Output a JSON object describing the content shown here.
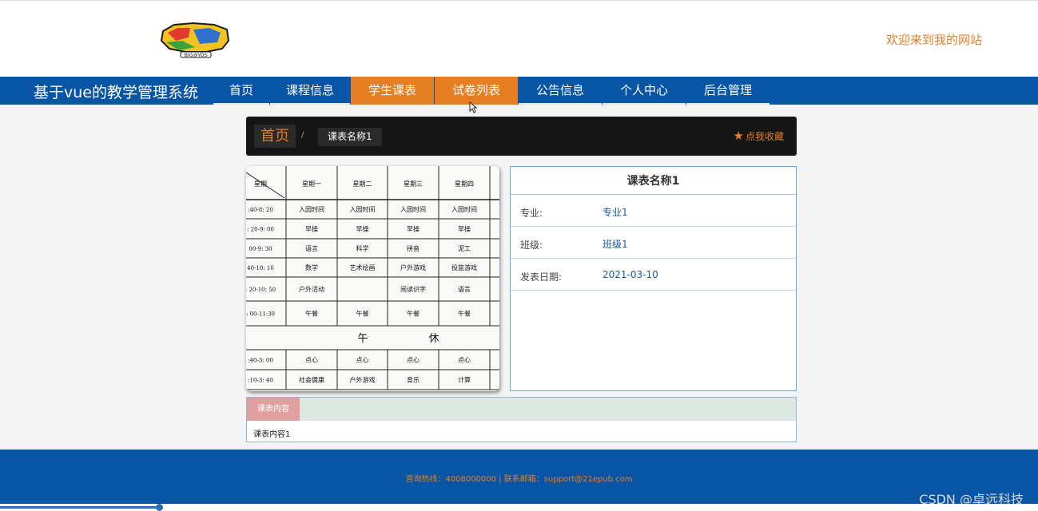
{
  "header": {
    "logo_text": "DIGIMON ADVENTURE BIG@YOS",
    "welcome": "欢迎来到我的网站"
  },
  "nav": {
    "brand": "基于vue的教学管理系统",
    "items": [
      {
        "label": "首页"
      },
      {
        "label": "课程信息"
      },
      {
        "label": "学生课表",
        "active": true
      },
      {
        "label": "试卷列表"
      },
      {
        "label": "公告信息"
      },
      {
        "label": "个人中心"
      },
      {
        "label": "后台管理"
      }
    ]
  },
  "breadcrumb": {
    "home": "首页",
    "separator": "/",
    "current": "课表名称1",
    "favorite": "点我收藏"
  },
  "schedule_image": {
    "headers": [
      "星期",
      "星期一",
      "星期二",
      "星期三",
      "星期四"
    ],
    "rows": [
      {
        "time": ":40-8: 20",
        "cells": [
          "入园时间",
          "入园时间",
          "入园时间",
          "入园时间"
        ]
      },
      {
        "time": ": 20-9: 00",
        "cells": [
          "早操",
          "早操",
          "早操",
          "早操"
        ]
      },
      {
        "time": "00-9: 30",
        "cells": [
          "语言",
          "科学",
          "拼音",
          "泥工"
        ]
      },
      {
        "time": "40-10: 10",
        "cells": [
          "数学",
          "艺术绘画",
          "户外游戏",
          "投篮游戏"
        ]
      },
      {
        "time": ": 20-10: 50",
        "cells": [
          "户外活动",
          "",
          "阅读识字",
          "语言"
        ]
      },
      {
        "time": ": 00-11:30",
        "cells": [
          "午餐",
          "午餐",
          "午餐",
          "午餐"
        ]
      },
      {
        "noon": [
          "午",
          "休"
        ]
      },
      {
        "time": ":40-3: 00",
        "cells": [
          "点心",
          "点心",
          "点心",
          "点心"
        ]
      },
      {
        "time": ":10-3: 40",
        "cells": [
          "社会健康",
          "户外游戏",
          "音乐",
          "计算"
        ]
      }
    ]
  },
  "detail": {
    "title": "课表名称1",
    "fields": [
      {
        "label": "专业:",
        "value": "专业1"
      },
      {
        "label": "班级:",
        "value": "班级1"
      },
      {
        "label": "发表日期:",
        "value": "2021-03-10"
      }
    ]
  },
  "content": {
    "tab": "课表内容",
    "text": "课表内容1"
  },
  "footer": {
    "text": "咨询热线：4008000000 | 联系邮箱：support@21epub.com",
    "watermark": "CSDN @卓远科技"
  },
  "progress": {
    "fraction": 0.153
  },
  "colors": {
    "accent": "#e67e22",
    "nav": "#0855a6"
  }
}
